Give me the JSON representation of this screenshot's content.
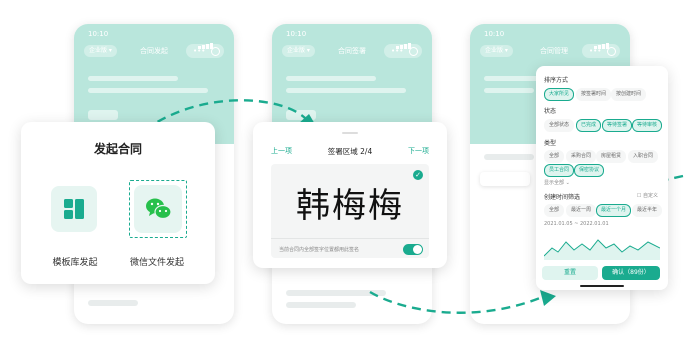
{
  "phones": [
    {
      "time": "10:10",
      "company": "企业版",
      "title": "合同发起"
    },
    {
      "time": "10:10",
      "company": "企业版",
      "title": "合同签署"
    },
    {
      "time": "10:10",
      "company": "企业版",
      "title": "合同管理"
    }
  ],
  "initiate_card": {
    "title": "发起合同",
    "options": [
      {
        "label": "模板库发起",
        "icon": "template-grid-icon"
      },
      {
        "label": "微信文件发起",
        "icon": "wechat-icon"
      }
    ]
  },
  "sign_card": {
    "prev": "上一项",
    "next": "下一项",
    "title": "签署区域 2/4",
    "signature": "韩梅梅",
    "apply_all": "当前合同内全部签字位置都用此签名",
    "toggle_on": true
  },
  "filter_panel": {
    "sort_label": "排序方式",
    "sort_options": [
      "大家所见",
      "按签署时间",
      "按创建时间"
    ],
    "status_label": "状态",
    "status_options": [
      "全部状态",
      "已完成",
      "等待签署",
      "等待审核"
    ],
    "type_label": "类型",
    "type_options": [
      "全部",
      "采购合同",
      "房屋租赁",
      "入职合同",
      "员工合同",
      "保密协议"
    ],
    "expand_label": "显示全部",
    "time_label": "创建时间筛选",
    "time_switch": "自定义",
    "time_options": [
      "全部",
      "最近一周",
      "最近一个月",
      "最近半年"
    ],
    "date_range": "2021.01.05 ~ 2022.01.01",
    "reset": "重置",
    "confirm": "确认（89份）"
  },
  "colors": {
    "accent": "#1aab8f",
    "header": "#b9e6dc",
    "arrow": "#1aab8f"
  }
}
